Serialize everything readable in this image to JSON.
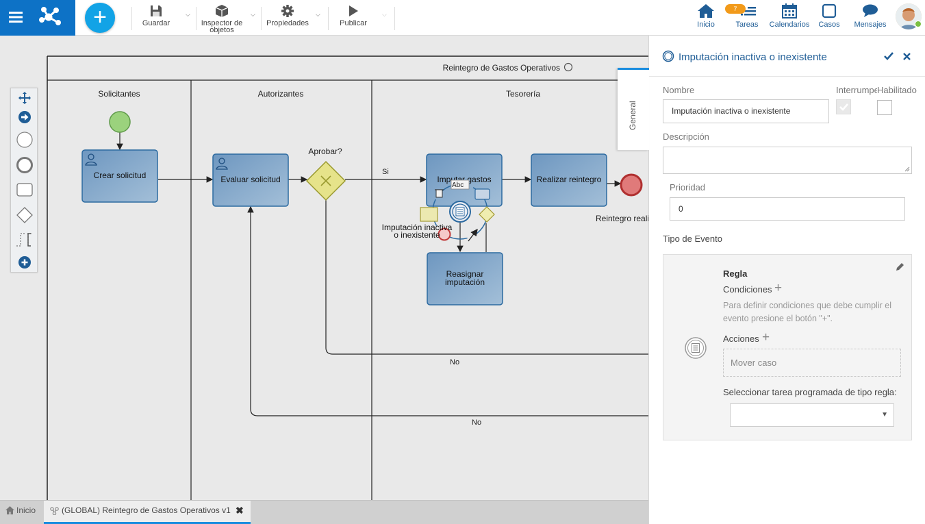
{
  "toolbar": {
    "save": "Guardar",
    "inspector_1": "Inspector de",
    "inspector_2": "objetos",
    "properties": "Propiedades",
    "publish": "Publicar"
  },
  "nav": {
    "home": "Inicio",
    "tasks": "Tareas",
    "tasks_badge": "7",
    "calendars": "Calendarios",
    "cases": "Casos",
    "messages": "Mensajes"
  },
  "diagram": {
    "pool_title": "Reintegro de Gastos Operativos",
    "lane_1": "Solicitantes",
    "lane_2": "Autorizantes",
    "lane_3": "Tesorería",
    "task_create": "Crear solicitud",
    "task_evaluate": "Evaluar solicitud",
    "task_impute": "Imputar gastos",
    "task_refund": "Realizar reintegro",
    "task_reassign_1": "Reasignar",
    "task_reassign_2": "imputación",
    "gateway_label": "Aprobar?",
    "flow_yes": "Si",
    "flow_no_1": "No",
    "flow_no_2": "No",
    "event_label_1": "Imputación inactiva",
    "event_label_2": "o inexistente",
    "end_label": "Reintegro reali",
    "context_text": "Abc"
  },
  "tabs": {
    "home": "Inicio",
    "process": "(GLOBAL) Reintegro de Gastos Operativos v1"
  },
  "panel": {
    "title": "Imputación inactiva o inexistente",
    "side_tab": "General",
    "name_label": "Nombre",
    "name_value": "Imputación inactiva o inexistente",
    "interrupts_label": "Interrumpe",
    "enabled_label": "Habilitado",
    "description_label": "Descripción",
    "priority_label": "Prioridad",
    "priority_value": "0",
    "event_type_label": "Tipo de Evento",
    "rule_title": "Regla",
    "conditions_label": "Condiciones",
    "conditions_hint": "Para definir condiciones que debe cumplir el evento presione el botón \"+\".",
    "actions_label": "Acciones",
    "action_item": "Mover caso",
    "scheduled_label": "Seleccionar tarea programada de tipo regla:",
    "select_value": ""
  },
  "colors": {
    "brand": "#0d72c6",
    "add_button": "#12a3e6",
    "link": "#1f5d96",
    "task_fill": "#7ea6cc",
    "task_stroke": "#2c6aa0",
    "start_event": "#9bd27d",
    "end_event": "#e07a7a",
    "gateway": "#e6e38a"
  }
}
